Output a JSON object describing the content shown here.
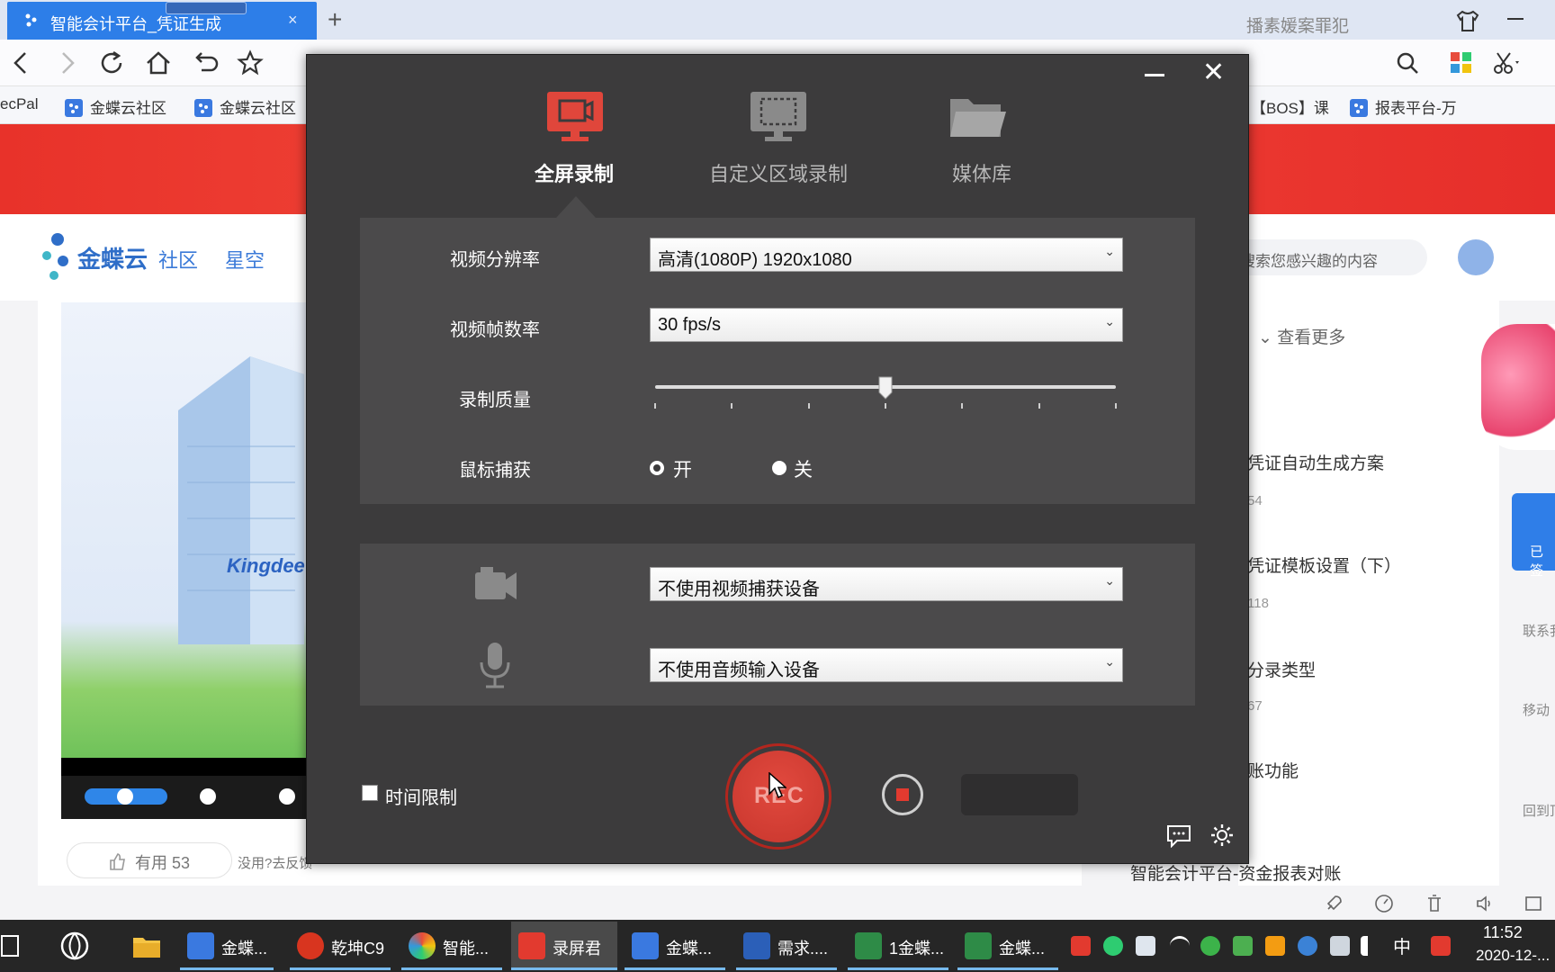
{
  "browser": {
    "tab_title": "智能会计平台_凭证生成",
    "close_tab_glyph": "×",
    "new_tab_glyph": "+",
    "address_partial": "播素媛案罪犯",
    "bookmarks": [
      "ecPal",
      "金蝶云社区",
      "金蝶云社区",
      "【BOS】课",
      "报表平台-万"
    ]
  },
  "site": {
    "logo_main": "金蝶云",
    "logo_sub": "社区",
    "logo_product": "星空",
    "search_placeholder": "搜索您感兴趣的内容",
    "hero_brand": "Kingdee",
    "useful": "有用 53",
    "useless": "没用?去反馈",
    "more_link": "查看更多",
    "articles": [
      {
        "title": "凭证自动生成方案",
        "meta": "54"
      },
      {
        "title": "凭证模板设置（下）",
        "meta": "118"
      },
      {
        "title": "分录类型",
        "meta": "67"
      },
      {
        "title": "账功能",
        "meta": ""
      }
    ],
    "bottom_article": "智能会计平台-资金报表对账",
    "sign_label": "已签",
    "side_contact": "联系我",
    "side_mobile": "移动",
    "side_top": "回到顶"
  },
  "recorder": {
    "close_glyph": "✕",
    "modes": [
      "全屏录制",
      "自定义区域录制",
      "媒体库"
    ],
    "active_mode": 0,
    "resolution_label": "视频分辨率",
    "resolution_value": "高清(1080P)   1920x1080",
    "fps_label": "视频帧数率",
    "fps_value": "30 fps/s",
    "quality_label": "录制质量",
    "quality_level": 0.5,
    "quality_ticks": 7,
    "mouse_label": "鼠标捕获",
    "mouse_on": "开",
    "mouse_off": "关",
    "mouse_capture": true,
    "camera_value": "不使用视频捕获设备",
    "audio_value": "不使用音频输入设备",
    "time_limit_label": "时间限制",
    "time_limit_checked": false,
    "rec_label": "REC"
  },
  "taskbar": {
    "items": [
      {
        "label": "金蝶...",
        "color": "#3a79e0"
      },
      {
        "label": "乾坤C9",
        "color": "#d8351f"
      },
      {
        "label": "智能...",
        "color": "#e98b2a"
      },
      {
        "label": "录屏君",
        "color": "#e23a2f"
      },
      {
        "label": "金蝶...",
        "color": "#3a79e0"
      },
      {
        "label": "需求....",
        "color": "#2b5fb8"
      },
      {
        "label": "1金蝶...",
        "color": "#2e8b47"
      },
      {
        "label": "金蝶...",
        "color": "#2e8b47"
      }
    ],
    "active_index": 3,
    "ime": "中",
    "time": "11:52",
    "date": "2020-12-..."
  },
  "colors": {
    "accent_red": "#e23a2f",
    "dialog_bg": "#3c3b3c",
    "panel_bg": "#4b4a4b",
    "browser_tab": "#2d7ee8"
  }
}
